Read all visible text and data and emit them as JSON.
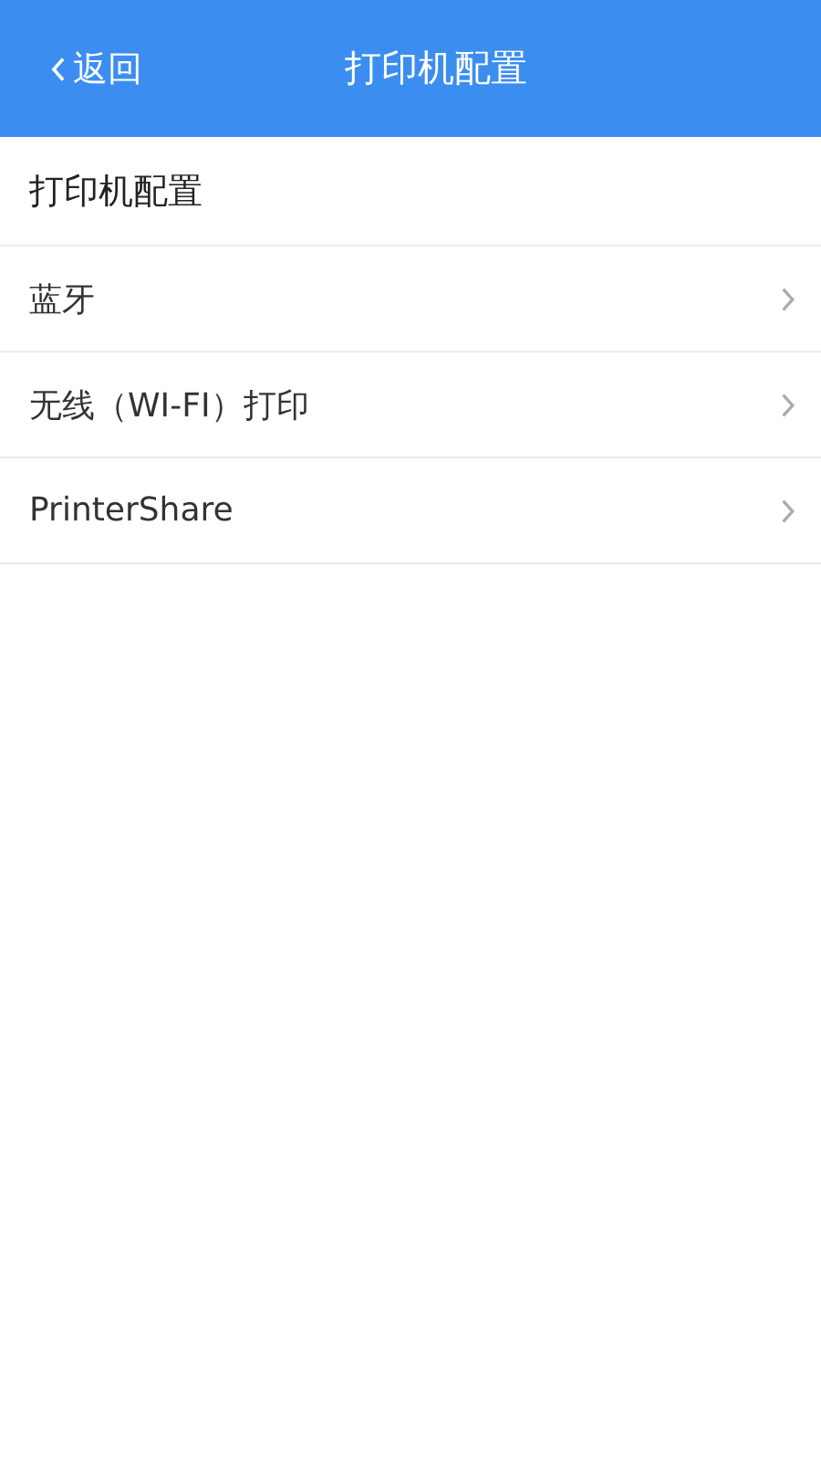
{
  "header": {
    "back": "返回",
    "title": "打印机配置"
  },
  "section_title": "打印机配置",
  "items": [
    {
      "label": "蓝牙"
    },
    {
      "label": "无线（WI-FI）打印"
    },
    {
      "label": "PrinterShare"
    }
  ]
}
